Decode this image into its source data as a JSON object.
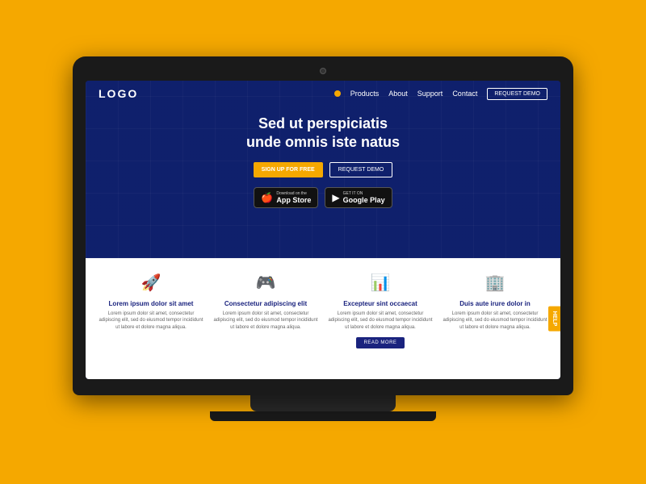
{
  "laptop": {
    "screen": {
      "navbar": {
        "logo": "LOGO",
        "links": [
          "Products",
          "About",
          "Support",
          "Contact"
        ],
        "demo_button": "REQUEST DEMO"
      },
      "hero": {
        "title_line1": "Sed ut perspiciatis",
        "title_line2": "unde omnis iste natus",
        "btn_signup": "SIGN UP FOR FREE",
        "btn_request": "REQUEST DEMO",
        "appstore_top": "Download on the",
        "appstore_name": "App Store",
        "googleplay_top": "GET IT ON",
        "googleplay_name": "Google Play"
      },
      "features": [
        {
          "icon": "🚀",
          "title": "Lorem ipsum dolor sit amet",
          "text": "Lorem ipsum dolor sit amet, consectetur adipiscing elit, sed do eiusmod tempor incididunt ut labore et dolore magna aliqua."
        },
        {
          "icon": "🎮",
          "title": "Consectetur adipiscing elit",
          "text": "Lorem ipsum dolor sit amet, consectetur adipiscing elit, sed do eiusmod tempor incididunt ut labore et dolore magna aliqua."
        },
        {
          "icon": "📊",
          "title": "Excepteur sint occaecat",
          "text": "Lorem ipsum dolor sit amet, consectetur adipiscing elit, sed do eiusmod tempor incididunt ut labore et dolore magna aliqua."
        },
        {
          "icon": "🏢",
          "title": "Duis aute irure dolor in",
          "text": "Lorem ipsum dolor sit amet, consectetur adipiscing elit, sed do eiusmod tempor incididunt ut labore et dolore magna aliqua."
        }
      ],
      "read_more": "READ MORE",
      "help": "HELP"
    }
  }
}
